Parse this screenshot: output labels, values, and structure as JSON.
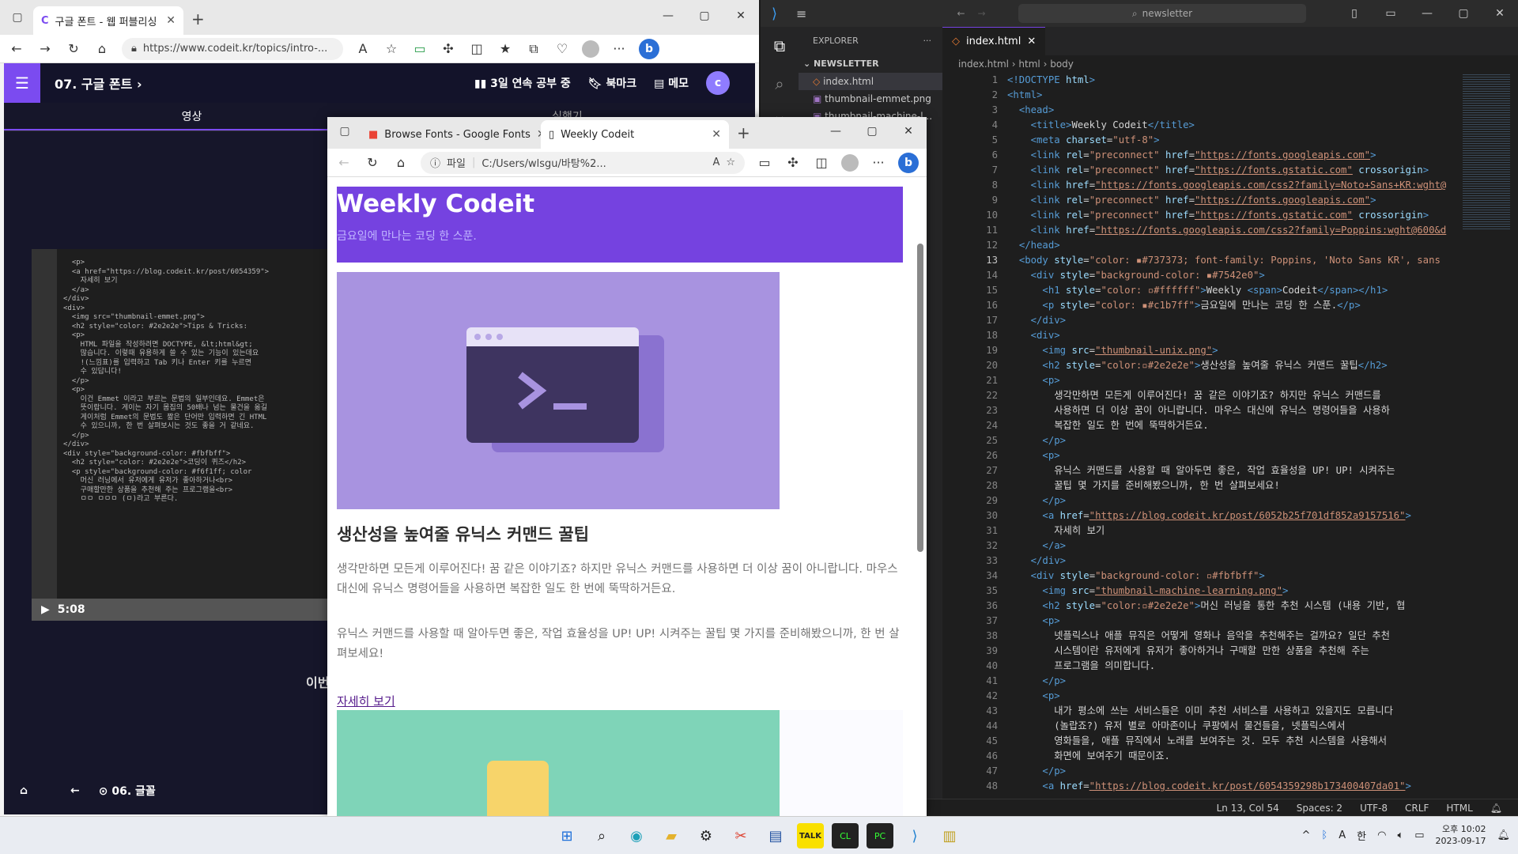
{
  "bg_browser": {
    "tab_title": "구글 폰트 - 웹 퍼블리싱 시작하기",
    "url": "https://www.codeit.kr/topics/intro-...",
    "lesson_title": "07. 구글 폰트",
    "streak": "3일 연속 공부 중",
    "bookmark": "북마크",
    "memo": "메모",
    "tab_video": "영상",
    "tab_practice": "실행기",
    "time": "5:08",
    "prev_lesson": "06. 글꼴",
    "this_part": "이번"
  },
  "fg_browser": {
    "tab1": "Browse Fonts - Google Fonts",
    "tab2": "Weekly Codeit",
    "file_label": "파일",
    "url": "C:/Users/wlsgu/바탕%2...",
    "h1": "Weekly Codeit",
    "subtitle": "금요일에 만나는 코딩 한 스푼.",
    "h2": "생산성을 높여줄 유닉스 커맨드 꿀팁",
    "p1": "생각만하면 모든게 이루어진다! 꿈 같은 이야기죠? 하지만 유닉스 커맨드를 사용하면 더 이상 꿈이 아니랍니다. 마우스 대신에 유닉스 명령어들을 사용하면 복잡한 일도 한 번에 뚝딱하거든요.",
    "p2": "유닉스 커맨드를 사용할 때 알아두면 좋은, 작업 효율성을 UP! UP! 시켜주는 꿀팁 몇 가지를 준비해봤으니까, 한 번 살펴보세요!",
    "link": "자세히 보기"
  },
  "vscode": {
    "search": "newsletter",
    "explorer_label": "EXPLORER",
    "section": "NEWSLETTER",
    "files": [
      "index.html",
      "thumbnail-emmet.png",
      "thumbnail-machine-l..."
    ],
    "tab": "index.html",
    "breadcrumb": [
      "index.html",
      "html",
      "body"
    ],
    "status": {
      "pos": "Ln 13, Col 54",
      "spaces": "Spaces: 2",
      "enc": "UTF-8",
      "eol": "CRLF",
      "lang": "HTML"
    }
  },
  "video_code": "  <p>\n  <a href=\"https://blog.codeit.kr/post/6054359\">\n    자세히 보기\n  </a>\n</div>\n<div>\n  <img src=\"thumbnail-emmet.png\">\n  <h2 style=\"color: #2e2e2e\">Tips & Tricks: \n  <p>\n    HTML 파일을 작성하려면 DOCTYPE, &lt;html&gt;\n    많습니다. 이렇때 유용하게 쓸 수 있는 기능이 있는데요\n    !(느낌표)를 입력하고 Tab 키나 Enter 키를 누르면\n    수 있답니다!\n  </p>\n  <p>\n    이건 Emmet 이라고 부르는 문법의 일부인데요. Emmet은\n    뜻이랍니다. 게이는 자기 몸집의 50배나 넘는 물건을 옮길\n    게이처럼 Emmet의 문법도 짧은 단어만 입력하면 긴 HTML\n    수 있으니까, 한 번 살펴보시는 것도 좋을 거 같네요.\n  </p>\n</div>\n<div style=\"background-color: #fbfbff\">\n  <h2 style=\"color: #2e2e2e\">코딩이 퀴즈</h2>\n  <p style=\"background-color: #f6f1ff; color\n    머신 러닝에서 유저에게 유저가 좋아하거나<br>\n    구매할만한 상품을 추천해 주는 프로그램을<br>\n    ㅁㅁ ㅁㅁㅁ (ㅁ)라고 부른다.",
  "taskbar": {
    "time": "오후 10:02",
    "date": "2023-09-17",
    "lang": "한"
  }
}
